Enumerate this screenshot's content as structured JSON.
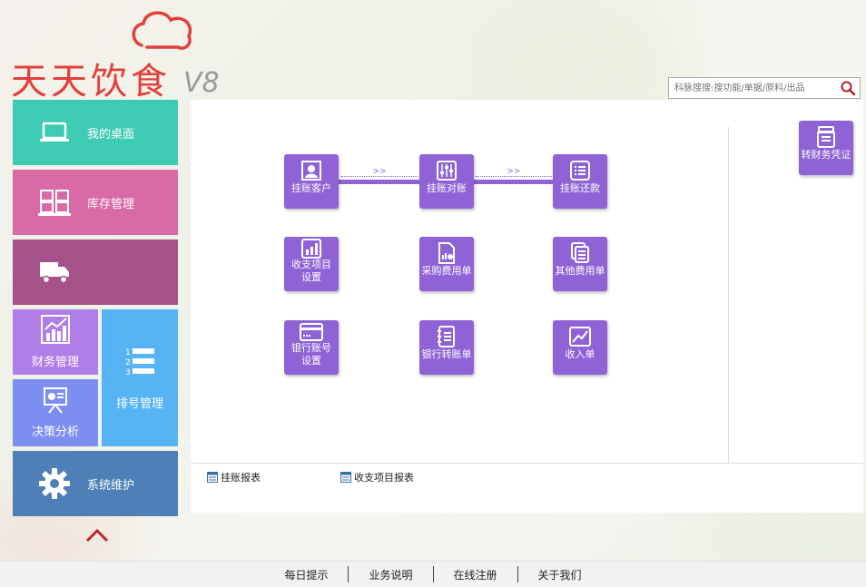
{
  "app": {
    "logo_text": "天天饮食",
    "version": "V8"
  },
  "search": {
    "placeholder": "科脉搜搜:搜功能/单据/原料/出品"
  },
  "sidebar": {
    "items": [
      {
        "label": "我的桌面",
        "icon": "laptop-icon",
        "color": "#3dcbb4"
      },
      {
        "label": "库存管理",
        "icon": "warehouse-icon",
        "color": "#d86aa5"
      },
      {
        "label": "",
        "icon": "truck-icon",
        "color": "#a5528a"
      },
      {
        "label": "财务管理",
        "icon": "chart-up-icon",
        "color": "#b17de6"
      },
      {
        "label": "决策分析",
        "icon": "presentation-icon",
        "color": "#7c8ff0"
      },
      {
        "label": "排号管理",
        "icon": "numbered-list-icon",
        "color": "#56b4f4"
      },
      {
        "label": "系统维护",
        "icon": "gear-icon",
        "color": "#4e7fb6"
      }
    ]
  },
  "main": {
    "flow_arrow_text": ">>",
    "buttons": [
      {
        "label": "挂账客户",
        "icon": "customer-icon"
      },
      {
        "label": "挂账对账",
        "icon": "sliders-icon"
      },
      {
        "label": "挂账还款",
        "icon": "list-icon"
      },
      {
        "label": "收支项目设置",
        "icon": "bar-chart-icon"
      },
      {
        "label": "采购费用单",
        "icon": "doc-chart-icon"
      },
      {
        "label": "其他费用单",
        "icon": "docs-icon"
      },
      {
        "label": "银行账号设置",
        "icon": "card-icon"
      },
      {
        "label": "银行转账单",
        "icon": "notebook-icon"
      },
      {
        "label": "收入单",
        "icon": "line-chart-icon"
      }
    ],
    "side_button": {
      "label": "转财务凭证",
      "icon": "voucher-icon"
    },
    "reports": [
      {
        "label": "挂账报表"
      },
      {
        "label": "收支项目报表"
      }
    ]
  },
  "footer": {
    "links": [
      "每日提示",
      "业务说明",
      "在线注册",
      "关于我们"
    ]
  },
  "colors": {
    "accent": "#8f63d5",
    "logo": "#e2403a"
  }
}
